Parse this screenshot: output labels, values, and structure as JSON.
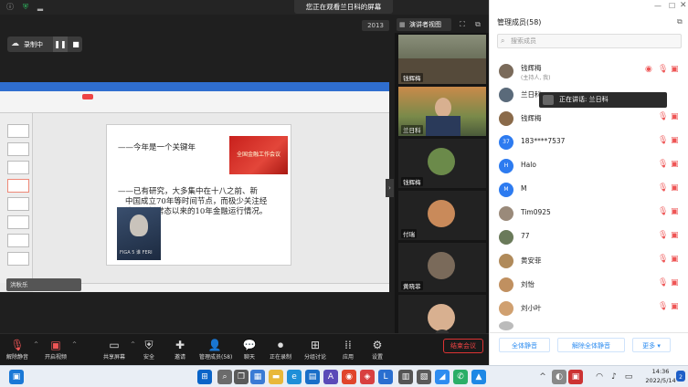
{
  "top": {
    "share_banner": "您正在观看兰日科的屏幕",
    "video_counter": "2013",
    "view_label": "演讲者视图",
    "fullscreen_icon": "fullscreen-icon",
    "popout_icon": "popout-icon"
  },
  "recording": {
    "label": "录制中",
    "pause_icon": "pause-icon",
    "stop_icon": "stop-icon"
  },
  "slide": {
    "bullet1": "——今年是一个关键年",
    "bullet2_line1": "——已有研究，大多集中在十八之前、新",
    "bullet2_line2": "中国成立70年等时间节点，而极少关注经",
    "bullet2_line3": "济进入新常态以来的10年金融运行情况。",
    "img1_caption": "全国金融工作会议",
    "img2_caption": "FIGA 5 谁 FERI"
  },
  "my_tile_label": "洪秋乐",
  "gallery": [
    {
      "name": "钱辉梅"
    },
    {
      "name": "兰日科"
    },
    {
      "name": "钱辉梅"
    },
    {
      "name": "付瑞"
    },
    {
      "name": "黄晓菲"
    },
    {
      "name": ""
    }
  ],
  "toolbar": {
    "mute": "解除静音",
    "video": "开启视频",
    "share": "共享屏幕",
    "security": "安全",
    "invite": "邀请",
    "participants": "管理成员(58)",
    "chat": "聊天",
    "record": "正在录制",
    "breakout": "分组讨论",
    "apps": "应用",
    "settings": "设置",
    "end": "结束会议"
  },
  "panel": {
    "title": "管理成员(58)",
    "search_placeholder": "搜索成员",
    "speaking": "正在讲话: 兰日科",
    "participants": [
      {
        "name": "钱辉梅",
        "sub": "(主持人, 我)",
        "color": "#7a6a5a"
      },
      {
        "name": "兰日科",
        "sub": "",
        "color": "#5a6a7a"
      },
      {
        "name": "钱辉梅",
        "sub": "",
        "color": "#8a6a4a"
      },
      {
        "name": "183****7537",
        "sub": "",
        "color": "#2d7bf0",
        "initial": "37"
      },
      {
        "name": "Halo",
        "sub": "",
        "color": "#2d7bf0",
        "initial": "H"
      },
      {
        "name": "M",
        "sub": "",
        "color": "#2d7bf0",
        "initial": "M"
      },
      {
        "name": "Tim0925",
        "sub": "",
        "color": "#9a8a7a"
      },
      {
        "name": "77",
        "sub": "",
        "color": "#6a7a5a"
      },
      {
        "name": "黄安菲",
        "sub": "",
        "color": "#b08a5a"
      },
      {
        "name": "刘怡",
        "sub": "",
        "color": "#c09060"
      },
      {
        "name": "刘小叶",
        "sub": "",
        "color": "#d0a070"
      },
      {
        "name": "",
        "sub": "",
        "color": "#bbb"
      }
    ],
    "mute_all": "全体静音",
    "unmute_all": "解除全体静音",
    "more": "更多"
  },
  "taskbar": {
    "time": "14:36",
    "date": "2022/5/14"
  }
}
